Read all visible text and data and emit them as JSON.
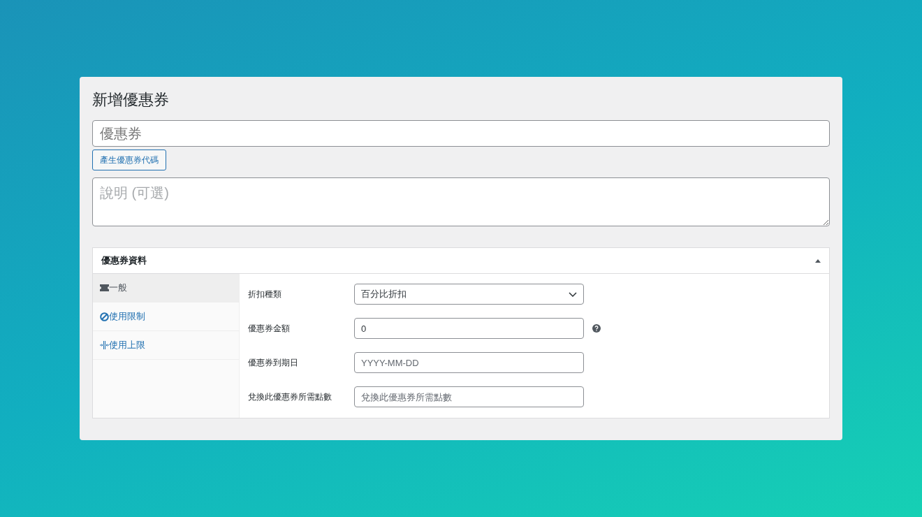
{
  "page_title": "新增優惠券",
  "coupon_code": {
    "placeholder": "優惠券"
  },
  "generate_button": "產生優惠券代碼",
  "description": {
    "placeholder": "說明 (可選)"
  },
  "panel": {
    "title": "優惠券資料",
    "expanded": true,
    "tabs": [
      {
        "label": "一般",
        "selected": true
      },
      {
        "label": "使用限制",
        "selected": false
      },
      {
        "label": "使用上限",
        "selected": false
      }
    ],
    "fields": [
      {
        "label": "折扣種類",
        "kind": "select",
        "value": "百分比折扣",
        "help": false
      },
      {
        "label": "優惠券金額",
        "kind": "input",
        "value": "0",
        "help": true
      },
      {
        "label": "優惠券到期日",
        "kind": "input",
        "placeholder": "YYYY-MM-DD",
        "help": false
      },
      {
        "label": "兌換此優惠券所需點數",
        "kind": "input",
        "placeholder": "兌換此優惠券所需點數",
        "help": false
      }
    ]
  }
}
